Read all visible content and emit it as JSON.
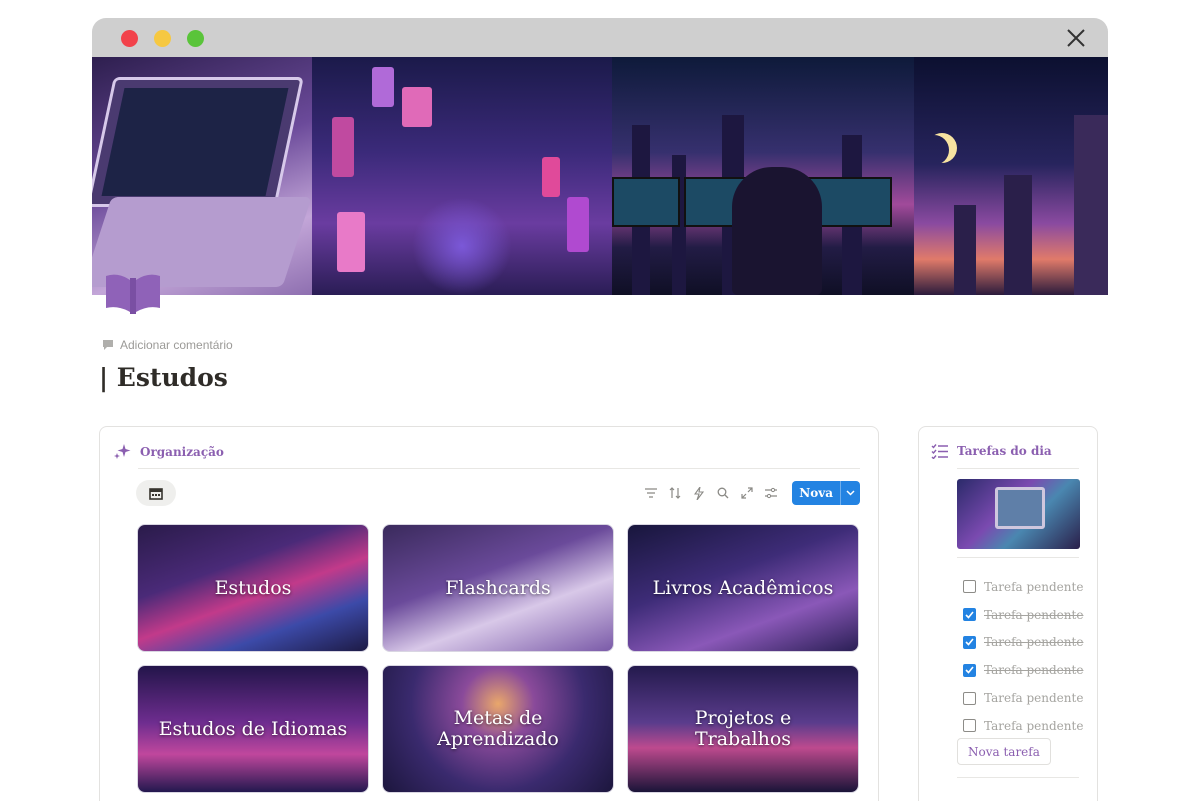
{
  "window": {
    "close_icon": "close-icon"
  },
  "page": {
    "icon": "open-book-icon",
    "add_comment_label": "Adicionar comentário",
    "title": "| Estudos"
  },
  "organization": {
    "title": "Organização",
    "icon": "sparkles-icon",
    "view_tab_icon": "calendar-icon",
    "toolbar": {
      "filter_icon": "filter-icon",
      "sort_icon": "sort-icon",
      "automation_icon": "lightning-icon",
      "search_icon": "search-icon",
      "expand_icon": "expand-icon",
      "settings_icon": "sliders-icon",
      "new_label": "Nova"
    },
    "cards": [
      {
        "label": "Estudos"
      },
      {
        "label": "Flashcards"
      },
      {
        "label": "Livros Acadêmicos"
      },
      {
        "label": "Estudos de Idiomas"
      },
      {
        "label": "Metas de Aprendizado"
      },
      {
        "label": "Projetos e Trabalhos"
      }
    ]
  },
  "tasks": {
    "title": "Tarefas do dia",
    "icon": "checklist-icon",
    "items": [
      {
        "label": "Tarefa pendente",
        "checked": false
      },
      {
        "label": "Tarefa pendente",
        "checked": true
      },
      {
        "label": "Tarefa pendente",
        "checked": true
      },
      {
        "label": "Tarefa pendente",
        "checked": true
      },
      {
        "label": "Tarefa pendente",
        "checked": false
      },
      {
        "label": "Tarefa pendente",
        "checked": false
      }
    ],
    "new_task_label": "Nova tarefa"
  },
  "colors": {
    "accent_purple": "#8b5fb0",
    "button_blue": "#2383e2",
    "titlebar_gray": "#cfcfcf"
  }
}
